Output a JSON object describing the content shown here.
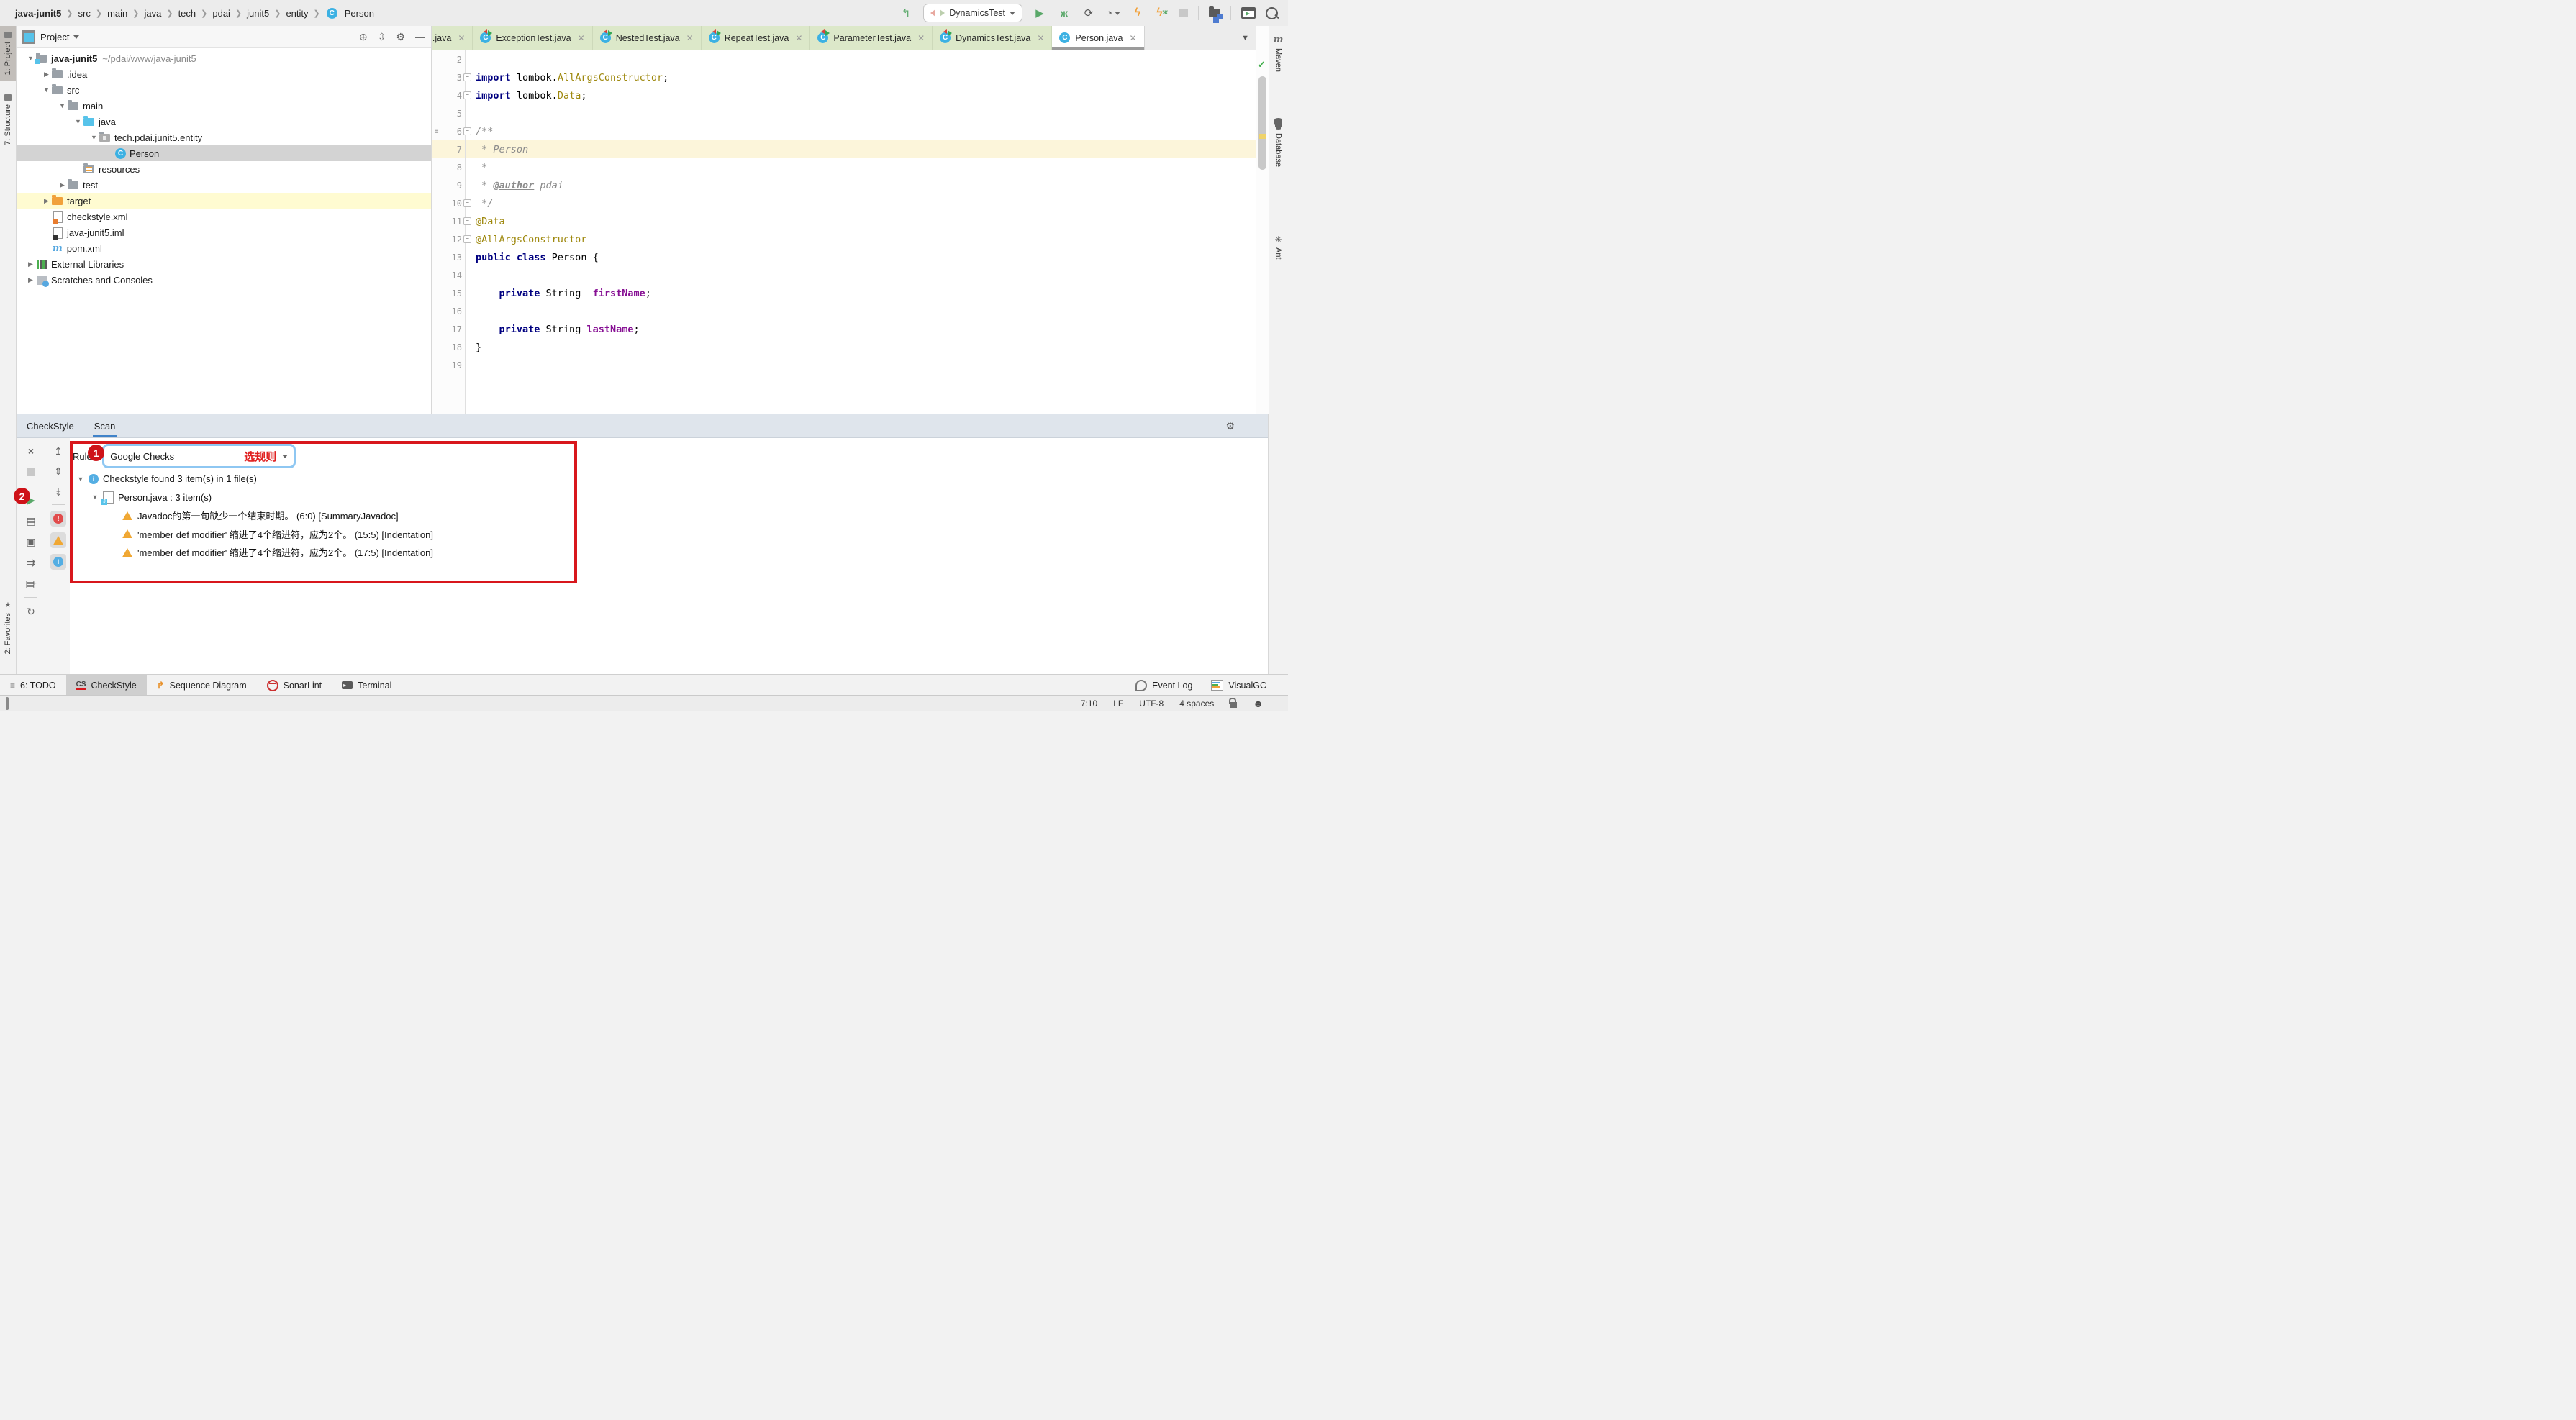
{
  "colors": {
    "accent_red": "#D8171C",
    "tab_green": "#DCE8C9",
    "selection_gray": "#D3D3D3",
    "row_yellow": "#FFFBD1",
    "line_highlight": "#FCF5DA",
    "keyword": "#000080",
    "annotation": "#9E880D",
    "comment": "#8C8C8C",
    "field": "#871094",
    "scan_underline": "#4083C9",
    "run_green": "#59A869",
    "warn_orange": "#F0A732"
  },
  "titlebar": {
    "breadcrumb": [
      "java-junit5",
      "src",
      "main",
      "java",
      "tech",
      "pdai",
      "junit5",
      "entity",
      "Person"
    ],
    "run_config": "DynamicsTest"
  },
  "left_strip": {
    "project": "1: Project",
    "structure": "7: Structure",
    "favorites": "2: Favorites"
  },
  "right_strip": {
    "maven": "Maven",
    "database": "Database",
    "ant": "Ant"
  },
  "project_panel": {
    "title": "Project",
    "tree": [
      {
        "label": "java-junit5",
        "suffix": "~/pdai/www/java-junit5",
        "level": 0,
        "arrow": "down",
        "icon": "f-root",
        "bold": true
      },
      {
        "label": ".idea",
        "level": 1,
        "arrow": "right",
        "icon": "folder"
      },
      {
        "label": "src",
        "level": 1,
        "arrow": "down",
        "icon": "folder"
      },
      {
        "label": "main",
        "level": 2,
        "arrow": "down",
        "icon": "folder"
      },
      {
        "label": "java",
        "level": 3,
        "arrow": "down",
        "icon": "f-blue"
      },
      {
        "label": "tech.pdai.junit5.entity",
        "level": 4,
        "arrow": "down",
        "icon": "f-pkg"
      },
      {
        "label": "Person",
        "level": 5,
        "arrow": "none",
        "icon": "class",
        "state": "sel"
      },
      {
        "label": "resources",
        "level": 3,
        "arrow": "none",
        "icon": "f-res"
      },
      {
        "label": "test",
        "level": 2,
        "arrow": "right",
        "icon": "folder"
      },
      {
        "label": "target",
        "level": 1,
        "arrow": "right",
        "icon": "f-orange",
        "state": "hil"
      },
      {
        "label": "checkstyle.xml",
        "level": 1,
        "arrow": "none",
        "icon": "pg-xml"
      },
      {
        "label": "java-junit5.iml",
        "level": 1,
        "arrow": "none",
        "icon": "pg-iml"
      },
      {
        "label": "pom.xml",
        "level": 1,
        "arrow": "none",
        "icon": "maven"
      },
      {
        "label": "External Libraries",
        "level": 0,
        "arrow": "right",
        "icon": "libs"
      },
      {
        "label": "Scratches and Consoles",
        "level": 0,
        "arrow": "right",
        "icon": "scratches"
      }
    ]
  },
  "editor": {
    "tabs": [
      {
        "label": "Test.java",
        "icon": "none",
        "clipped": true
      },
      {
        "label": "ExceptionTest.java",
        "icon": "test"
      },
      {
        "label": "NestedTest.java",
        "icon": "test"
      },
      {
        "label": "RepeatTest.java",
        "icon": "test"
      },
      {
        "label": "ParameterTest.java",
        "icon": "test"
      },
      {
        "label": "DynamicsTest.java",
        "icon": "test"
      },
      {
        "label": "Person.java",
        "icon": "class",
        "active": true
      }
    ],
    "lines": [
      {
        "n": 2,
        "tokens": []
      },
      {
        "n": 3,
        "fold": true,
        "tokens": [
          [
            "k",
            "import"
          ],
          [
            "p",
            " lombok."
          ],
          [
            "an",
            "AllArgsConstructor"
          ],
          [
            "p",
            ";"
          ]
        ]
      },
      {
        "n": 4,
        "fold": true,
        "tokens": [
          [
            "k",
            "import"
          ],
          [
            "p",
            " lombok."
          ],
          [
            "an",
            "Data"
          ],
          [
            "p",
            ";"
          ]
        ]
      },
      {
        "n": 5,
        "tokens": []
      },
      {
        "n": 6,
        "fold": true,
        "gutter_icon": true,
        "tokens": [
          [
            "c",
            "/**"
          ]
        ]
      },
      {
        "n": 7,
        "hl": true,
        "tokens": [
          [
            "c",
            " * Person"
          ]
        ]
      },
      {
        "n": 8,
        "tokens": [
          [
            "c",
            " *"
          ]
        ]
      },
      {
        "n": 9,
        "tokens": [
          [
            "c",
            " * "
          ],
          [
            "tag",
            "@author"
          ],
          [
            "c",
            " pdai"
          ]
        ]
      },
      {
        "n": 10,
        "fold": true,
        "tokens": [
          [
            "c",
            " */"
          ]
        ]
      },
      {
        "n": 11,
        "fold": true,
        "tokens": [
          [
            "an",
            "@Data"
          ]
        ]
      },
      {
        "n": 12,
        "fold": true,
        "tokens": [
          [
            "an",
            "@AllArgsConstructor"
          ]
        ]
      },
      {
        "n": 13,
        "tokens": [
          [
            "k",
            "public class"
          ],
          [
            "p",
            " Person {"
          ]
        ]
      },
      {
        "n": 14,
        "tokens": []
      },
      {
        "n": 15,
        "tokens": [
          [
            "p",
            "    "
          ],
          [
            "k",
            "private"
          ],
          [
            "p",
            " String  "
          ],
          [
            "f",
            "firstName"
          ],
          [
            "p",
            ";"
          ]
        ]
      },
      {
        "n": 16,
        "tokens": []
      },
      {
        "n": 17,
        "tokens": [
          [
            "p",
            "    "
          ],
          [
            "k",
            "private"
          ],
          [
            "p",
            " String "
          ],
          [
            "f",
            "lastName"
          ],
          [
            "p",
            ";"
          ]
        ]
      },
      {
        "n": 18,
        "tokens": [
          [
            "p",
            "}"
          ]
        ]
      },
      {
        "n": 19,
        "tokens": []
      }
    ]
  },
  "tool_window": {
    "tab_checkstyle": "CheckStyle",
    "tab_scan": "Scan",
    "rules_label": "Rules",
    "rules_value": "Google Checks",
    "results": [
      {
        "kind": "group",
        "text": "Checkstyle found 3 item(s) in 1 file(s)",
        "chevron": true,
        "icon": "info",
        "indent": 10
      },
      {
        "kind": "file",
        "text": "Person.java : 3 item(s)",
        "chevron": true,
        "icon": "java-file",
        "indent": 30
      },
      {
        "kind": "warn",
        "text": "Javadoc的第一句缺少一个结束时期。 (6:0) [SummaryJavadoc]",
        "icon": "warning",
        "indent": 72
      },
      {
        "kind": "warn",
        "text": "'member def modifier' 缩进了4个缩进符，应为2个。 (15:5) [Indentation]",
        "icon": "warning",
        "indent": 72
      },
      {
        "kind": "warn",
        "text": "'member def modifier' 缩进了4个缩进符，应为2个。 (17:5) [Indentation]",
        "icon": "warning",
        "indent": 72
      }
    ]
  },
  "annotations": {
    "badge1": "1",
    "badge2": "2",
    "select_rule": "选规则"
  },
  "bottom_bar": {
    "left": [
      {
        "label": "6: TODO",
        "icon": "list"
      },
      {
        "label": "CheckStyle",
        "icon": "cs",
        "active": true
      },
      {
        "label": "Sequence Diagram",
        "icon": "seq"
      },
      {
        "label": "SonarLint",
        "icon": "sonar"
      },
      {
        "label": "Terminal",
        "icon": "term"
      }
    ],
    "right": [
      {
        "label": "Event Log",
        "icon": "balloon"
      },
      {
        "label": "VisualGC",
        "icon": "gc"
      }
    ]
  },
  "status_bar": {
    "position": "7:10",
    "line_ending": "LF",
    "encoding": "UTF-8",
    "indent": "4 spaces"
  }
}
